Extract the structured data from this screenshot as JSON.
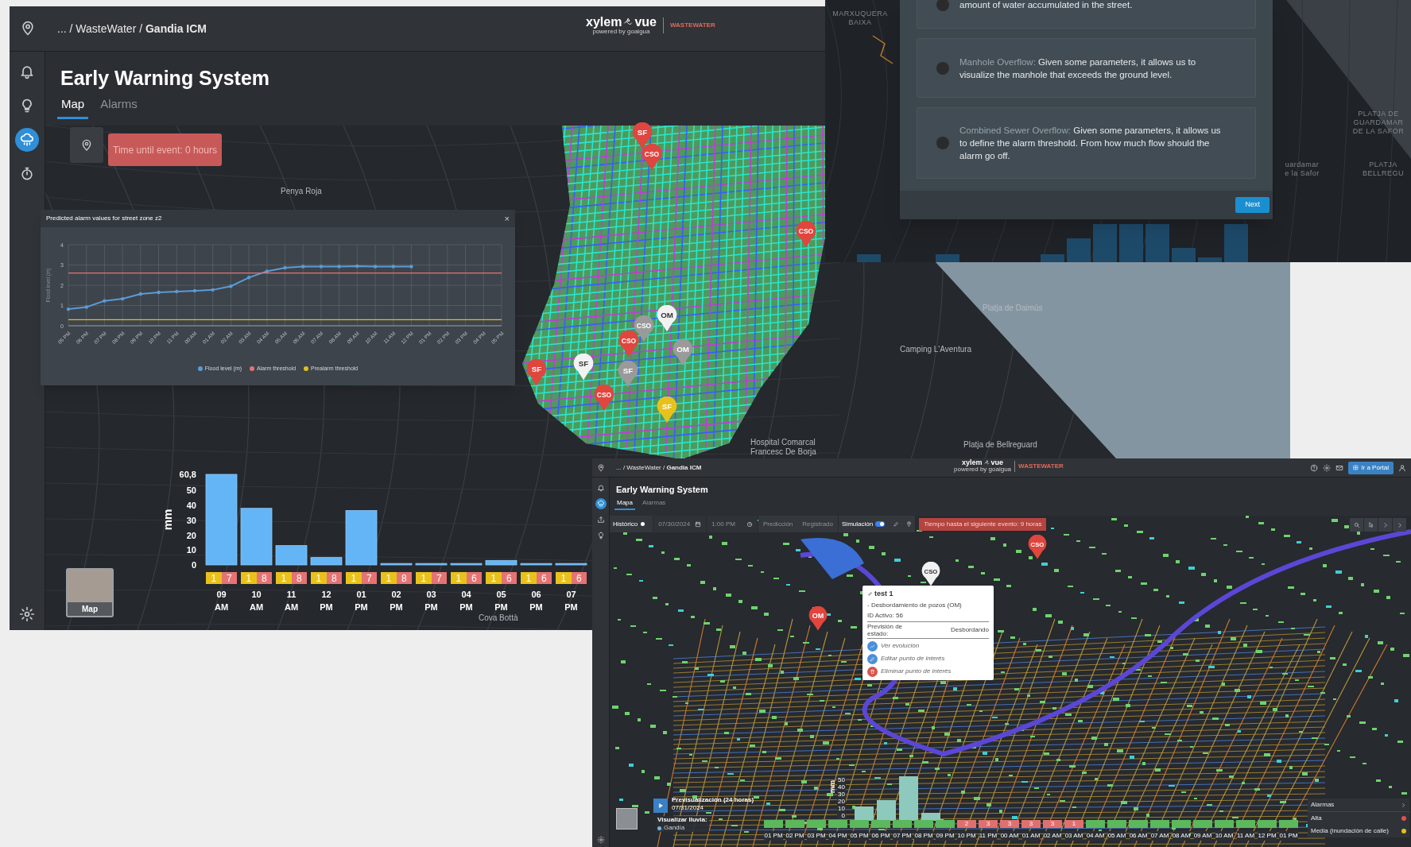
{
  "window_main": {
    "breadcrumb": {
      "prefix": "... / WasteWater / ",
      "current": "Gandia ICM"
    },
    "logo": {
      "brand": "xylem",
      "product": "vue",
      "tagline": "powered by goaigua",
      "section": "WASTEWATER"
    },
    "sidebar": [
      {
        "selected": false
      },
      {
        "selected": false
      },
      {
        "selected": true
      },
      {
        "selected": false
      }
    ],
    "title": "Early Warning System",
    "tabs": [
      {
        "label": "Map",
        "selected": true
      },
      {
        "label": "Alarms",
        "selected": false
      }
    ],
    "event_timer": "Time until event: 0 hours",
    "map_labels": [
      "Penya Roja",
      "Platja de Daimús",
      "Camping L'Aventura",
      "Hospital Comarcal",
      "Francesc De Borja",
      "Platja de Bellreguard",
      "Cova Bottà"
    ],
    "markers": [
      {
        "label": "SF",
        "color": "#e0453e"
      },
      {
        "label": "CSO",
        "color": "#e0453e"
      },
      {
        "label": "CSO",
        "color": "#e0453e"
      },
      {
        "label": "OM",
        "color": "#f2f2f2"
      },
      {
        "label": "CSO",
        "color": "#9a9a9a"
      },
      {
        "label": "OM",
        "color": "#9a9a9a"
      },
      {
        "label": "CSO",
        "color": "#e0453e"
      },
      {
        "label": "SF",
        "color": "#f2f2f2"
      },
      {
        "label": "SF",
        "color": "#9a9a9a"
      },
      {
        "label": "SF",
        "color": "#e0453e"
      },
      {
        "label": "CSO",
        "color": "#e0453e"
      },
      {
        "label": "SF",
        "color": "#e8c21a"
      }
    ],
    "chart_popup": {
      "title": "Predicted alarm values for street zone z2",
      "close": "×",
      "chart_data": {
        "type": "line",
        "grid": true,
        "legend": "bottom",
        "ylabel": "Flood level (m)",
        "categories": [
          "05 PM",
          "06 PM",
          "07 PM",
          "08 PM",
          "09 PM",
          "10 PM",
          "11 PM",
          "00 AM",
          "01 AM",
          "02 AM",
          "03 AM",
          "04 AM",
          "05 AM",
          "06 AM",
          "07 AM",
          "08 AM",
          "09 AM",
          "10 AM",
          "11 AM",
          "12 PM",
          "01 PM",
          "02 PM",
          "03 PM",
          "04 PM",
          "05 PM"
        ],
        "ylim": [
          0,
          4
        ],
        "yticks": [
          0,
          1,
          2,
          3,
          4
        ],
        "series": [
          {
            "name": "Flood level (m)",
            "color": "#5b9bd5",
            "values": [
              0.82,
              0.92,
              1.23,
              1.33,
              1.57,
              1.65,
              1.69,
              1.73,
              1.77,
              1.95,
              2.38,
              2.69,
              2.86,
              2.92,
              2.92,
              2.92,
              2.94,
              2.92,
              2.92,
              2.92,
              null,
              null,
              null,
              null,
              null
            ]
          },
          {
            "name": "Alarm threshold",
            "color": "#e57373",
            "values": [
              2.6,
              2.6,
              2.6,
              2.6,
              2.6,
              2.6,
              2.6,
              2.6,
              2.6,
              2.6,
              2.6,
              2.6,
              2.6,
              2.6,
              2.6,
              2.6,
              2.6,
              2.6,
              2.6,
              2.6,
              2.6,
              2.6,
              2.6,
              2.6,
              2.6
            ]
          },
          {
            "name": "Prealarm threshold",
            "color": "#e0c020",
            "values": [
              0.3,
              0.3,
              0.3,
              0.3,
              0.3,
              0.3,
              0.3,
              0.3,
              0.3,
              0.3,
              0.3,
              0.3,
              0.3,
              0.3,
              0.3,
              0.3,
              0.3,
              0.3,
              0.3,
              0.3,
              0.3,
              0.3,
              0.3,
              0.3,
              0.3
            ]
          }
        ]
      }
    },
    "rain_chart": {
      "chart_data": {
        "type": "bar",
        "ylabel": "mm",
        "categories": [
          "09 AM",
          "10 AM",
          "11 AM",
          "12 PM",
          "01 PM",
          "02 PM",
          "03 PM",
          "04 PM",
          "05 PM",
          "06 PM",
          "07 PM"
        ],
        "values": [
          60.8,
          38,
          13,
          5,
          36.5,
          1,
          1,
          1,
          3,
          1,
          1
        ],
        "ylim": [
          0,
          60.8
        ],
        "yticks": [
          0,
          10,
          20,
          30,
          40,
          50,
          {
            "value": 60.8,
            "label": "60,8"
          }
        ]
      },
      "slots": [
        {
          "prealarm": "1",
          "alarm": "7"
        },
        {
          "prealarm": "1",
          "alarm": "8"
        },
        {
          "prealarm": "1",
          "alarm": "8"
        },
        {
          "prealarm": "1",
          "alarm": "8"
        },
        {
          "prealarm": "1",
          "alarm": "7"
        },
        {
          "prealarm": "1",
          "alarm": "8"
        },
        {
          "prealarm": "1",
          "alarm": "7"
        },
        {
          "prealarm": "1",
          "alarm": "6"
        },
        {
          "prealarm": "1",
          "alarm": "6"
        },
        {
          "prealarm": "1",
          "alarm": "6"
        },
        {
          "prealarm": "1",
          "alarm": "6"
        }
      ]
    },
    "basemap_toggle": {
      "label": "Map"
    }
  },
  "window_modal": {
    "map_labels": [
      "MARXUQUERA BAIXA",
      "PLATJA DE GUARDAMAR DE LA SAFOR",
      "uardamar",
      "e la Safor",
      "PLATJA BELLREGU"
    ],
    "options": [
      {
        "text": "amount of water accumulated in the street.",
        "selected": false
      },
      {
        "name": "Manhole Overflow:",
        "text": "Given some parameters, it allows us to visualize the manhole that exceeds the ground level.",
        "selected": false
      },
      {
        "name": "Combined Sewer Overflow:",
        "text": "Given some parameters, it allows us to define the alarm threshold. From how much flow should the alarm go off.",
        "selected": false
      }
    ],
    "next_button": "Next"
  },
  "window_secondary": {
    "breadcrumb": {
      "prefix": "... / WasteWater / ",
      "current": "Gandia ICM"
    },
    "logo": {
      "brand": "xylem",
      "product": "vue",
      "tagline": "powered by goaigua",
      "section": "WASTEWATER"
    },
    "portal_button": "Ir a Portal",
    "sidebar": [
      {
        "selected": false
      },
      {
        "selected": true
      },
      {
        "selected": false
      },
      {
        "selected": false
      }
    ],
    "title": "Early Warning System",
    "tabs": [
      {
        "label": "Mapa",
        "selected": true
      },
      {
        "label": "Alarmas",
        "selected": false
      }
    ],
    "toolbar": {
      "historic": {
        "label": "Histórico",
        "on": false
      },
      "date": "07/30/2024",
      "time": "1:00 PM",
      "prediction": "Predicción",
      "recorded": "Registrado",
      "simulation": {
        "label": "Simulación",
        "on": true
      },
      "banner": "Tiempo hasta el siguiente evento: 9 horas"
    },
    "popup": {
      "title": "test 1",
      "type": "- Desbordamiento de pozos (OM)",
      "asset_id": "ID Activo: 56",
      "status_label": "Previsión de estado:",
      "status_value": "Desbordando",
      "actions": [
        "Ver evolución",
        "Editar punto de interés",
        "Eliminar punto de interés"
      ]
    },
    "map_markers": [
      {
        "label": "CSO",
        "color": "#e0453e"
      },
      {
        "label": "CSO",
        "color": "#f2f2f2"
      },
      {
        "label": "OM",
        "color": "#e0453e"
      }
    ],
    "preview": {
      "title": "Previsualización (24 horas)",
      "date": "07/31/2024",
      "rain_label": "Visualizar lluvia:",
      "rain_option": "Gandía"
    },
    "rain_axis": {
      "label": "mm",
      "ticks": [
        "50",
        "40",
        "30",
        "20",
        "10",
        "0"
      ]
    },
    "timeline": [
      {
        "time": "01 PM",
        "alert": false
      },
      {
        "time": "02 PM",
        "alert": false
      },
      {
        "time": "03 PM",
        "alert": false
      },
      {
        "time": "04 PM",
        "alert": false
      },
      {
        "time": "05 PM",
        "alert": false
      },
      {
        "time": "06 PM",
        "alert": false
      },
      {
        "time": "07 PM",
        "alert": false
      },
      {
        "time": "08 PM",
        "alert": false
      },
      {
        "time": "09 PM",
        "alert": false
      },
      {
        "time": "10 PM",
        "alert": true,
        "count": "2"
      },
      {
        "time": "11 PM",
        "alert": true,
        "count": "3"
      },
      {
        "time": "00 AM",
        "alert": true,
        "count": "3"
      },
      {
        "time": "01 AM",
        "alert": true,
        "count": "3"
      },
      {
        "time": "02 AM",
        "alert": true,
        "count": "3"
      },
      {
        "time": "03 AM",
        "alert": true,
        "count": "1"
      },
      {
        "time": "04 AM",
        "alert": false
      },
      {
        "time": "05 AM",
        "alert": false
      },
      {
        "time": "06 AM",
        "alert": false
      },
      {
        "time": "07 AM",
        "alert": false
      },
      {
        "time": "08 AM",
        "alert": false
      },
      {
        "time": "09 AM",
        "alert": false
      },
      {
        "time": "10 AM",
        "alert": false
      },
      {
        "time": "11 AM",
        "alert": false
      },
      {
        "time": "12 PM",
        "alert": false
      },
      {
        "time": "01 PM",
        "alert": false
      }
    ],
    "legend": {
      "title": "Alarmas",
      "items": [
        {
          "label": "Alta",
          "color": "#e05050"
        },
        {
          "label": "Media (inundación de calle)",
          "color": "#e0c020"
        }
      ]
    }
  }
}
